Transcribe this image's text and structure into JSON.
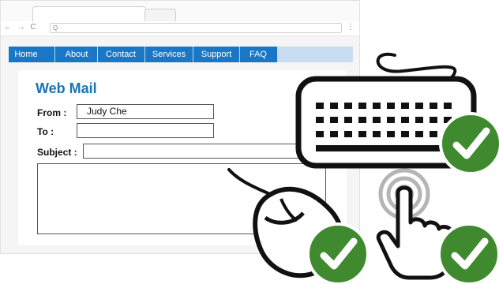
{
  "browser": {
    "nav_buttons": "← → C",
    "url": "Q",
    "menu": "⋮"
  },
  "navbar": {
    "items": [
      "Home",
      "About",
      "Contact",
      "Services",
      "Support",
      "FAQ"
    ]
  },
  "form": {
    "title": "Web Mail",
    "from_label": "From :",
    "from_value": "Judy Che",
    "to_label": "To :",
    "to_value": "",
    "subject_label": "Subject :",
    "subject_value": "",
    "body_value": ""
  },
  "colors": {
    "nav_blue": "#1878c7",
    "title_blue": "#1a73b8",
    "check_green": "#3f8a2e"
  },
  "icons": [
    "keyboard-icon",
    "mouse-icon",
    "hand-touch-icon",
    "checkmark-icon"
  ]
}
